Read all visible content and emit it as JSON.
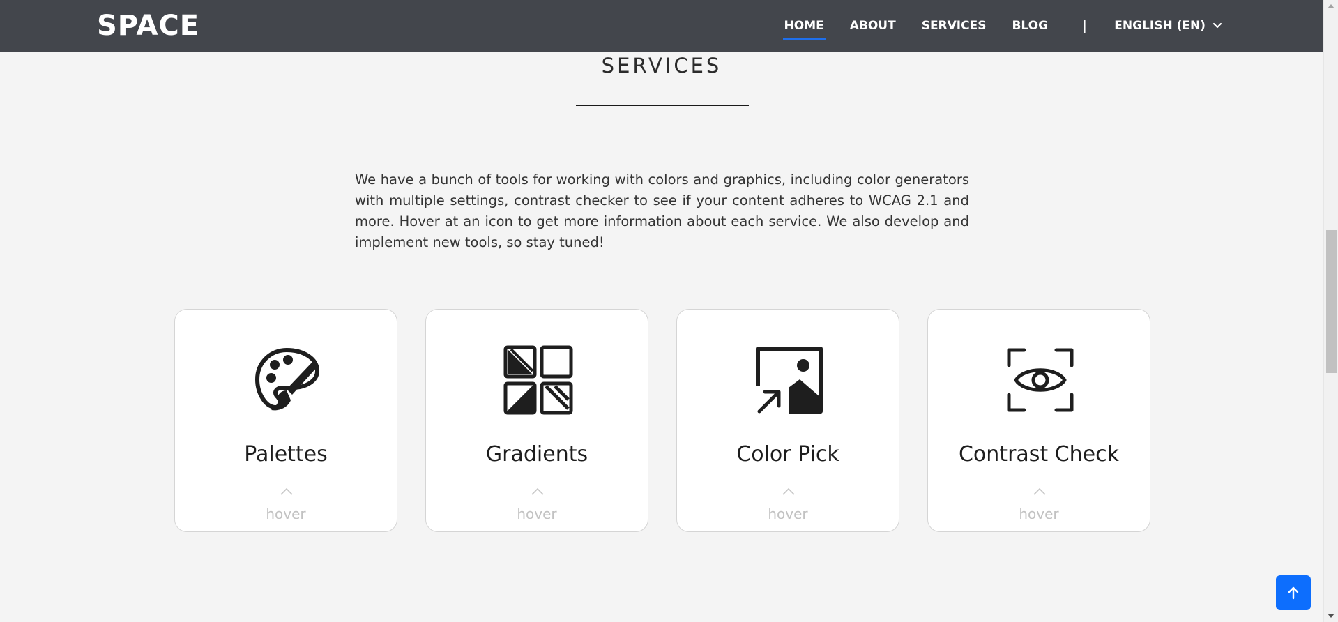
{
  "header": {
    "brand": "SPACE",
    "nav": [
      {
        "label": "HOME",
        "active": true
      },
      {
        "label": "ABOUT",
        "active": false
      },
      {
        "label": "SERVICES",
        "active": false
      },
      {
        "label": "BLOG",
        "active": false
      }
    ],
    "separator": "|",
    "language": "ENGLISH (EN)"
  },
  "section": {
    "title": "SERVICES",
    "intro": "We have a bunch of tools for working with colors and graphics, including color generators with multiple settings, contrast checker to see if your content adheres to WCAG 2.1 and more. Hover at an icon to get more information about each service. We also develop and implement new tools, so stay tuned!"
  },
  "cards": [
    {
      "title": "Palettes",
      "icon": "palette-icon",
      "hint": "hover"
    },
    {
      "title": "Gradients",
      "icon": "gradient-grid-icon",
      "hint": "hover"
    },
    {
      "title": "Color Pick",
      "icon": "image-picker-icon",
      "hint": "hover"
    },
    {
      "title": "Contrast Check",
      "icon": "eye-scan-icon",
      "hint": "hover"
    }
  ],
  "colors": {
    "navbar": "#43464c",
    "active_underline": "#1f6feb",
    "back_to_top": "#0d6efd",
    "page_bg": "#f4f4f4"
  },
  "back_to_top": {
    "icon": "arrow-up-icon"
  }
}
